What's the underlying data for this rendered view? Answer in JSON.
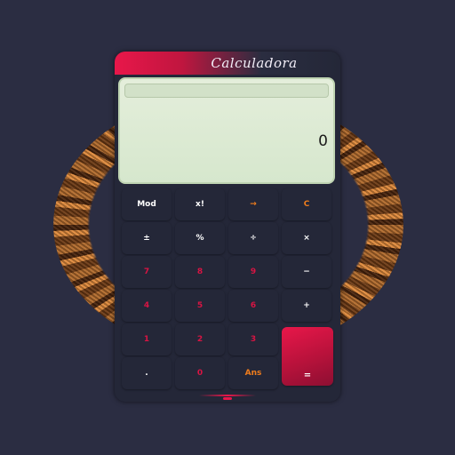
{
  "app": {
    "title": "Calculadora"
  },
  "display": {
    "history": "",
    "value": "0"
  },
  "keys": {
    "mod": "Mod",
    "factorial": "x!",
    "backspace": "→",
    "clear": "C",
    "plus_minus": "±",
    "percent": "%",
    "divide": "÷",
    "multiply": "×",
    "seven": "7",
    "eight": "8",
    "nine": "9",
    "minus": "−",
    "four": "4",
    "five": "5",
    "six": "6",
    "plus": "+",
    "one": "1",
    "two": "2",
    "three": "3",
    "decimal": ".",
    "zero": "0",
    "ans": "Ans",
    "equals": "="
  },
  "colors": {
    "background": "#2b2d42",
    "panel": "#242738",
    "accent_red": "#e8174a",
    "accent_orange": "#f07d1c",
    "display": "#d6e7cd"
  }
}
